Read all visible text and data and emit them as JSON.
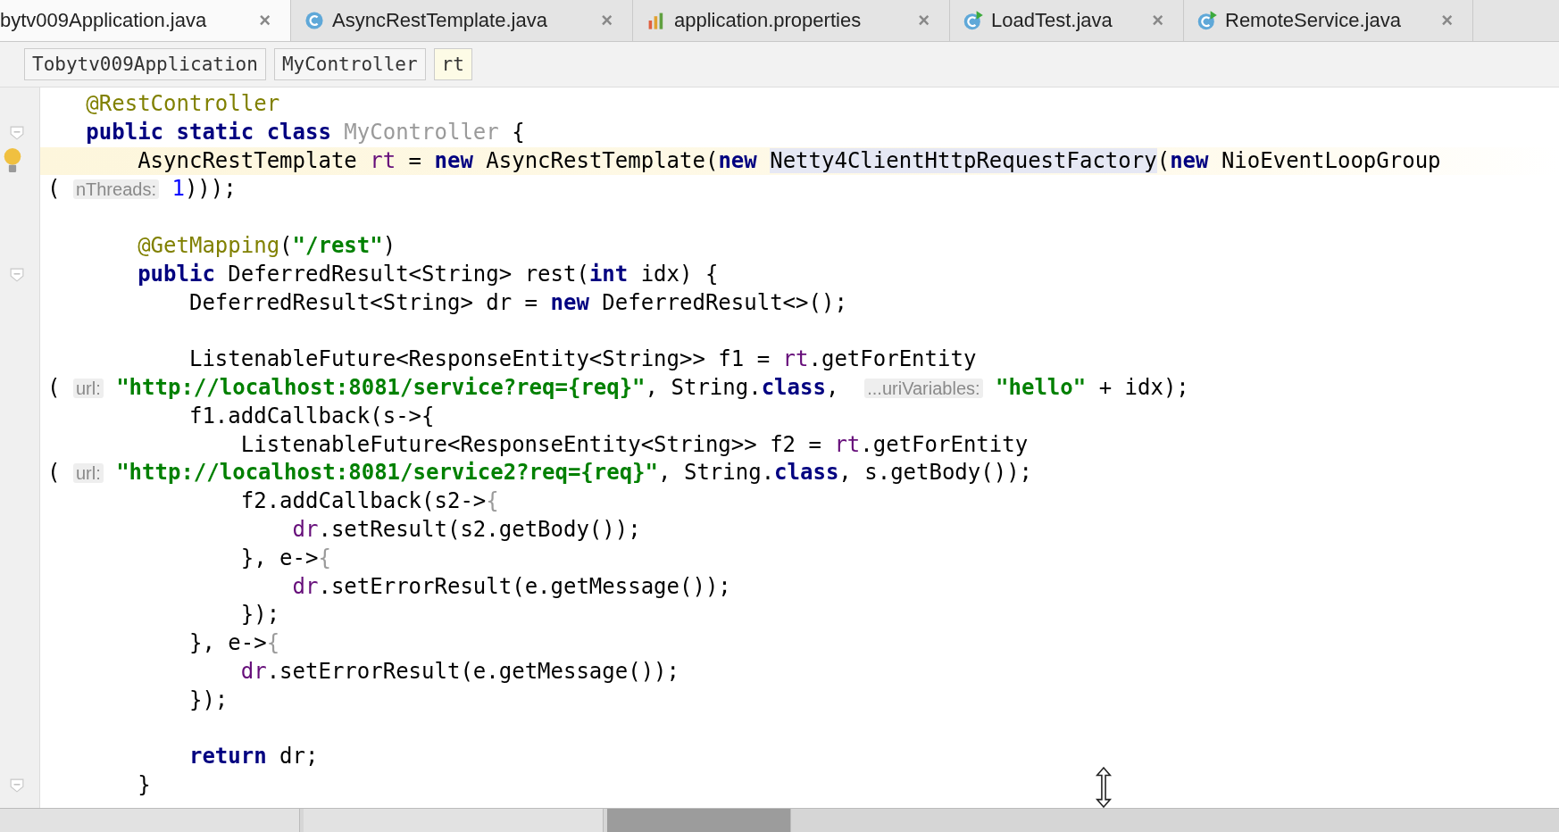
{
  "tabs": [
    {
      "label": "bytv009Application.java",
      "close": "×",
      "selected": true
    },
    {
      "label": "AsyncRestTemplate.java",
      "close": "×",
      "selected": false
    },
    {
      "label": "application.properties",
      "close": "×",
      "selected": false
    },
    {
      "label": "LoadTest.java",
      "close": "×",
      "selected": false
    },
    {
      "label": "RemoteService.java",
      "close": "×",
      "selected": false
    }
  ],
  "breadcrumbs": [
    {
      "label": "Tobytv009Application",
      "selected": false
    },
    {
      "label": "MyController",
      "selected": false
    },
    {
      "label": "rt",
      "selected": true
    }
  ],
  "code_lines": [
    {
      "current": false,
      "kind": "plain",
      "tokens": [
        {
          "kind": "anno",
          "text": "   @RestController"
        }
      ]
    },
    {
      "current": false,
      "kind": "fold",
      "tokens": [
        {
          "kind": "kw",
          "text": "   public static class "
        },
        {
          "kind": "muted",
          "text": "MyController"
        },
        {
          "kind": "plain",
          "text": " {"
        }
      ]
    },
    {
      "current": true,
      "kind": "bulb",
      "tokens": [
        {
          "kind": "plain",
          "text": "       AsyncRestTemplate "
        },
        {
          "kind": "field",
          "text": "rt"
        },
        {
          "kind": "plain",
          "text": " = "
        },
        {
          "kind": "kw",
          "text": "new "
        },
        {
          "kind": "plain",
          "text": "AsyncRestTemplate("
        },
        {
          "kind": "kw",
          "text": "new "
        },
        {
          "kind": "ref",
          "text": "Netty4ClientHttpRequestFactory"
        },
        {
          "kind": "plain",
          "text": "("
        },
        {
          "kind": "kw",
          "text": "new "
        },
        {
          "kind": "plain",
          "text": "NioEventLoopGroup"
        }
      ]
    },
    {
      "current": false,
      "kind": "plain",
      "tokens": [
        {
          "kind": "plain",
          "text": "( "
        },
        {
          "kind": "hint",
          "text": "nThreads:"
        },
        {
          "kind": "num",
          "text": " 1"
        },
        {
          "kind": "plain",
          "text": ")));"
        }
      ]
    },
    {
      "current": false,
      "kind": "plain"
    },
    {
      "current": false,
      "kind": "plain",
      "tokens": [
        {
          "kind": "anno",
          "text": "       @GetMapping"
        },
        {
          "kind": "plain",
          "text": "("
        },
        {
          "kind": "str",
          "text": "\"/rest\""
        },
        {
          "kind": "plain",
          "text": ")"
        }
      ]
    },
    {
      "current": false,
      "kind": "fold",
      "tokens": [
        {
          "kind": "kw",
          "text": "       public "
        },
        {
          "kind": "plain",
          "text": "DeferredResult<String> rest("
        },
        {
          "kind": "kw",
          "text": "int "
        },
        {
          "kind": "plain",
          "text": "idx) {"
        }
      ]
    },
    {
      "current": false,
      "kind": "plain",
      "tokens": [
        {
          "kind": "plain",
          "text": "           DeferredResult<String> dr = "
        },
        {
          "kind": "kw",
          "text": "new "
        },
        {
          "kind": "plain",
          "text": "DeferredResult<>();"
        }
      ]
    },
    {
      "current": false,
      "kind": "plain"
    },
    {
      "current": false,
      "kind": "plain",
      "tokens": [
        {
          "kind": "plain",
          "text": "           ListenableFuture<ResponseEntity<String>> f1 = "
        },
        {
          "kind": "field",
          "text": "rt"
        },
        {
          "kind": "plain",
          "text": ".getForEntity"
        }
      ]
    },
    {
      "current": false,
      "kind": "plain",
      "tokens": [
        {
          "kind": "plain",
          "text": "( "
        },
        {
          "kind": "hint",
          "text": "url:"
        },
        {
          "kind": "str",
          "text": " \"http://localhost:8081/service?req={req}\""
        },
        {
          "kind": "plain",
          "text": ", String."
        },
        {
          "kind": "kw",
          "text": "class"
        },
        {
          "kind": "plain",
          "text": ",  "
        },
        {
          "kind": "hint",
          "text": "...uriVariables:"
        },
        {
          "kind": "str",
          "text": " \"hello\""
        },
        {
          "kind": "plain",
          "text": " + idx);"
        }
      ]
    },
    {
      "current": false,
      "kind": "plain",
      "tokens": [
        {
          "kind": "plain",
          "text": "           f1.addCallback(s->{"
        }
      ]
    },
    {
      "current": false,
      "kind": "plain",
      "tokens": [
        {
          "kind": "plain",
          "text": "               ListenableFuture<ResponseEntity<String>> f2 = "
        },
        {
          "kind": "field",
          "text": "rt"
        },
        {
          "kind": "plain",
          "text": ".getForEntity"
        }
      ]
    },
    {
      "current": false,
      "kind": "plain",
      "tokens": [
        {
          "kind": "plain",
          "text": "( "
        },
        {
          "kind": "hint",
          "text": "url:"
        },
        {
          "kind": "str",
          "text": " \"http://localhost:8081/service2?req={req}\""
        },
        {
          "kind": "plain",
          "text": ", String."
        },
        {
          "kind": "kw",
          "text": "class"
        },
        {
          "kind": "plain",
          "text": ", s.getBody());"
        }
      ]
    },
    {
      "current": false,
      "kind": "plain",
      "tokens": [
        {
          "kind": "plain",
          "text": "               f2.addCallback(s2->"
        },
        {
          "kind": "muted",
          "text": "{"
        }
      ]
    },
    {
      "current": false,
      "kind": "plain",
      "tokens": [
        {
          "kind": "field",
          "text": "                   dr"
        },
        {
          "kind": "plain",
          "text": ".setResult(s2.getBody());"
        }
      ]
    },
    {
      "current": false,
      "kind": "plain",
      "tokens": [
        {
          "kind": "plain",
          "text": "               }, e->"
        },
        {
          "kind": "muted",
          "text": "{"
        }
      ]
    },
    {
      "current": false,
      "kind": "plain",
      "tokens": [
        {
          "kind": "field",
          "text": "                   dr"
        },
        {
          "kind": "plain",
          "text": ".setErrorResult(e.getMessage());"
        }
      ]
    },
    {
      "current": false,
      "kind": "plain",
      "tokens": [
        {
          "kind": "plain",
          "text": "               });"
        }
      ]
    },
    {
      "current": false,
      "kind": "plain",
      "tokens": [
        {
          "kind": "plain",
          "text": "           }, e->"
        },
        {
          "kind": "muted",
          "text": "{"
        }
      ]
    },
    {
      "current": false,
      "kind": "plain",
      "tokens": [
        {
          "kind": "field",
          "text": "               dr"
        },
        {
          "kind": "plain",
          "text": ".setErrorResult(e.getMessage());"
        }
      ]
    },
    {
      "current": false,
      "kind": "plain",
      "tokens": [
        {
          "kind": "plain",
          "text": "           });"
        }
      ]
    },
    {
      "current": false,
      "kind": "plain"
    },
    {
      "current": false,
      "kind": "plain",
      "tokens": [
        {
          "kind": "kw",
          "text": "           return "
        },
        {
          "kind": "plain",
          "text": "dr;"
        }
      ]
    },
    {
      "current": false,
      "kind": "fold",
      "tokens": [
        {
          "kind": "plain",
          "text": "       }"
        }
      ]
    }
  ],
  "bottom_tabs": [
    {
      "selected": false
    },
    {
      "selected": false
    },
    {
      "selected": true
    }
  ]
}
